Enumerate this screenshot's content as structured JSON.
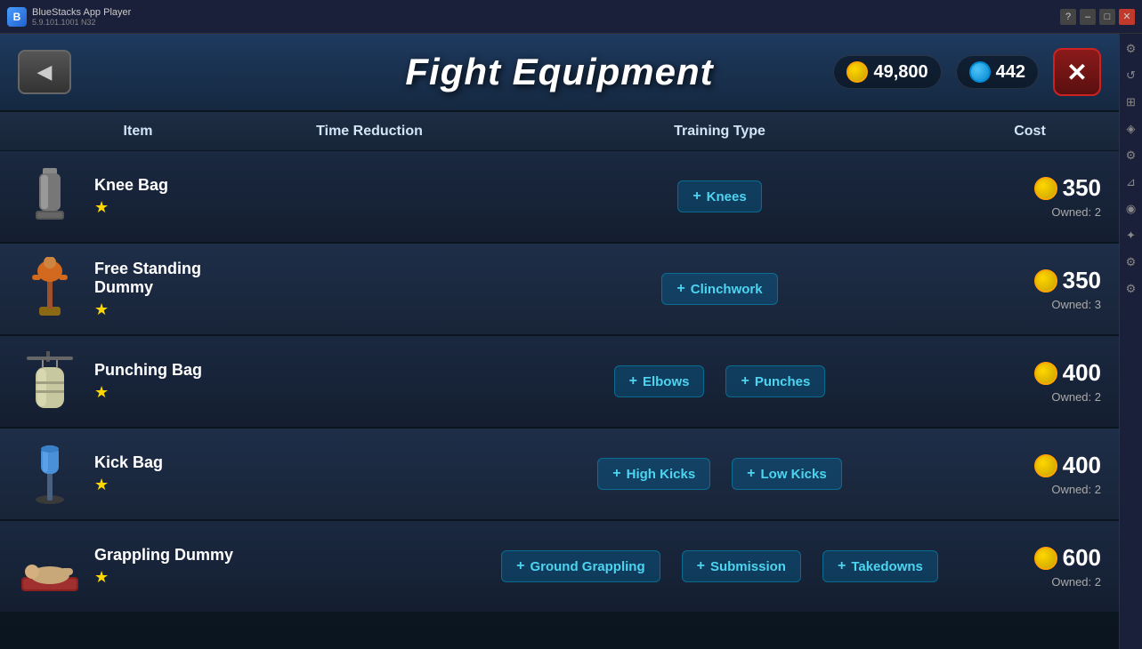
{
  "titleBar": {
    "appName": "BlueStacks App Player",
    "version": "5.9.101.1001 N32",
    "homeBtn": "⌂",
    "multiBtn": "⧉",
    "helpBtn": "?",
    "minimizeBtn": "–",
    "restoreBtn": "□",
    "closeBtn": "✕"
  },
  "header": {
    "title": "Fight Equipment",
    "backArrow": "◀",
    "closeX": "✕",
    "coins": "49,800",
    "gems": "442"
  },
  "table": {
    "columns": [
      "Item",
      "Time Reduction",
      "Training Type",
      "Cost"
    ],
    "rows": [
      {
        "name": "Knee Bag",
        "stars": "★",
        "trainingTypes": [
          "Knees"
        ],
        "cost": "350",
        "owned": "Owned: 2"
      },
      {
        "name": "Free Standing Dummy",
        "stars": "★",
        "trainingTypes": [
          "Clinchwork"
        ],
        "cost": "350",
        "owned": "Owned: 3"
      },
      {
        "name": "Punching Bag",
        "stars": "★",
        "trainingTypes": [
          "Elbows",
          "Punches"
        ],
        "cost": "400",
        "owned": "Owned: 2"
      },
      {
        "name": "Kick Bag",
        "stars": "★",
        "trainingTypes": [
          "High Kicks",
          "Low Kicks"
        ],
        "cost": "400",
        "owned": "Owned: 2"
      },
      {
        "name": "Grappling Dummy",
        "stars": "★",
        "trainingTypes": [
          "Ground Grappling",
          "Submission",
          "Takedowns"
        ],
        "cost": "600",
        "owned": "Owned: 2"
      }
    ]
  },
  "sidebarIcons": [
    "⚙",
    "🔄",
    "⊞",
    "◈",
    "🔧",
    "⚙",
    "◉",
    "✦",
    "⚙"
  ]
}
